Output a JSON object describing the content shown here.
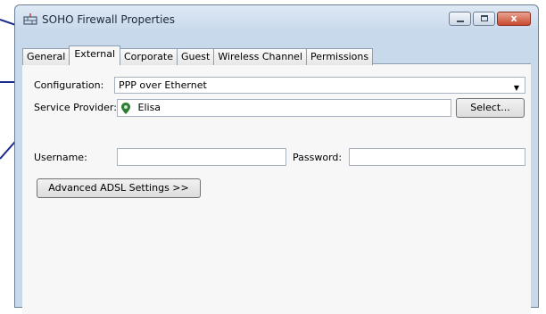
{
  "window": {
    "title": "SOHO Firewall Properties",
    "close_glyph": "x"
  },
  "tabs": [
    {
      "label": "General"
    },
    {
      "label": "External"
    },
    {
      "label": "Corporate"
    },
    {
      "label": "Guest"
    },
    {
      "label": "Wireless Channel"
    },
    {
      "label": "Permissions"
    }
  ],
  "active_tab": "External",
  "form": {
    "configuration_label": "Configuration:",
    "configuration_value": "PPP over Ethernet",
    "service_provider_label": "Service Provider:",
    "service_provider_value": "Elisa",
    "select_button": "Select...",
    "username_label": "Username:",
    "username_value": "",
    "password_label": "Password:",
    "password_value": "",
    "advanced_button": "Advanced ADSL Settings >>"
  },
  "icons": {
    "title": "network-firewall-icon",
    "provider": "map-pin-icon",
    "dropdown": "chevron-down-icon"
  },
  "colors": {
    "callout_line": "#1a2a8c",
    "title_bar": "#c9d9ec",
    "close_button": "#c8492f"
  }
}
